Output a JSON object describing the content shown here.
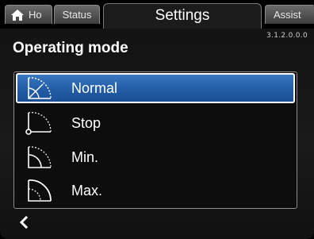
{
  "tabs": {
    "home": "Ho",
    "status": "Status",
    "settings": "Settings",
    "assist": "Assist"
  },
  "version": "3.1.2.0.0.0",
  "page_title": "Operating mode",
  "items": [
    {
      "label": "Normal",
      "icon": "normal-mode-icon",
      "selected": true
    },
    {
      "label": "Stop",
      "icon": "stop-mode-icon",
      "selected": false
    },
    {
      "label": "Min.",
      "icon": "min-mode-icon",
      "selected": false
    },
    {
      "label": "Max.",
      "icon": "max-mode-icon",
      "selected": false
    }
  ],
  "back_icon": "chevron-left-icon",
  "colors": {
    "selection": "#245ea8",
    "background": "#111111",
    "text": "#ffffff"
  }
}
